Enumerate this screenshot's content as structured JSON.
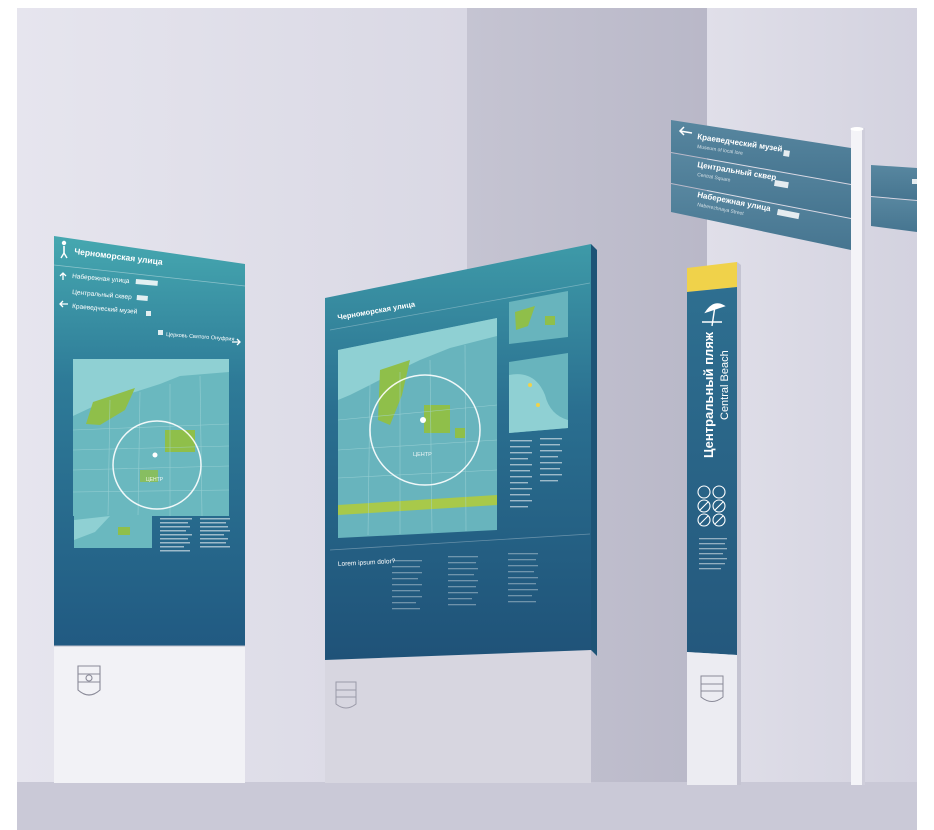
{
  "colors": {
    "wall": "#dcdbe7",
    "floor": "#c9c8d6",
    "sign_top": "#3d9ea9",
    "sign_bottom": "#1f5a80",
    "map_water": "#7fc7cc",
    "map_green": "#8fbf4a",
    "accent_yellow": "#f0d24a",
    "pointer_blue": "#4d7a95"
  },
  "sign_left": {
    "title": "Черноморская улица",
    "directions": [
      {
        "label": "Набережная улица",
        "arrow": "arrow-up-icon"
      },
      {
        "label": "Центральный сквер",
        "arrow": "arrow-up-icon"
      },
      {
        "label": "Краеведческий музей",
        "arrow": "arrow-left-icon"
      },
      {
        "label": "Церковь Святого Онуфрия",
        "arrow": "arrow-right-icon"
      }
    ],
    "map_labels": [
      "ЦЕНТР"
    ]
  },
  "sign_center": {
    "title": "Черноморская улица",
    "map_labels": [
      "ЦЕНТР"
    ],
    "lower_heading": "Lorem ipsum dolor?"
  },
  "pole": {
    "label_ru": "Центральный пляж",
    "label_en": "Central Beach",
    "icon": "beach-umbrella-icon"
  },
  "pointers": [
    {
      "label_ru": "Краеведческий музей",
      "label_en": "Museum of local lore",
      "arrow": "arrow-left-icon"
    },
    {
      "label_ru": "Центральный сквер",
      "label_en": "Central Square",
      "arrow": "none"
    },
    {
      "label_ru": "Набережная улица",
      "label_en": "Naberezhnaya Street",
      "arrow": "none"
    }
  ]
}
